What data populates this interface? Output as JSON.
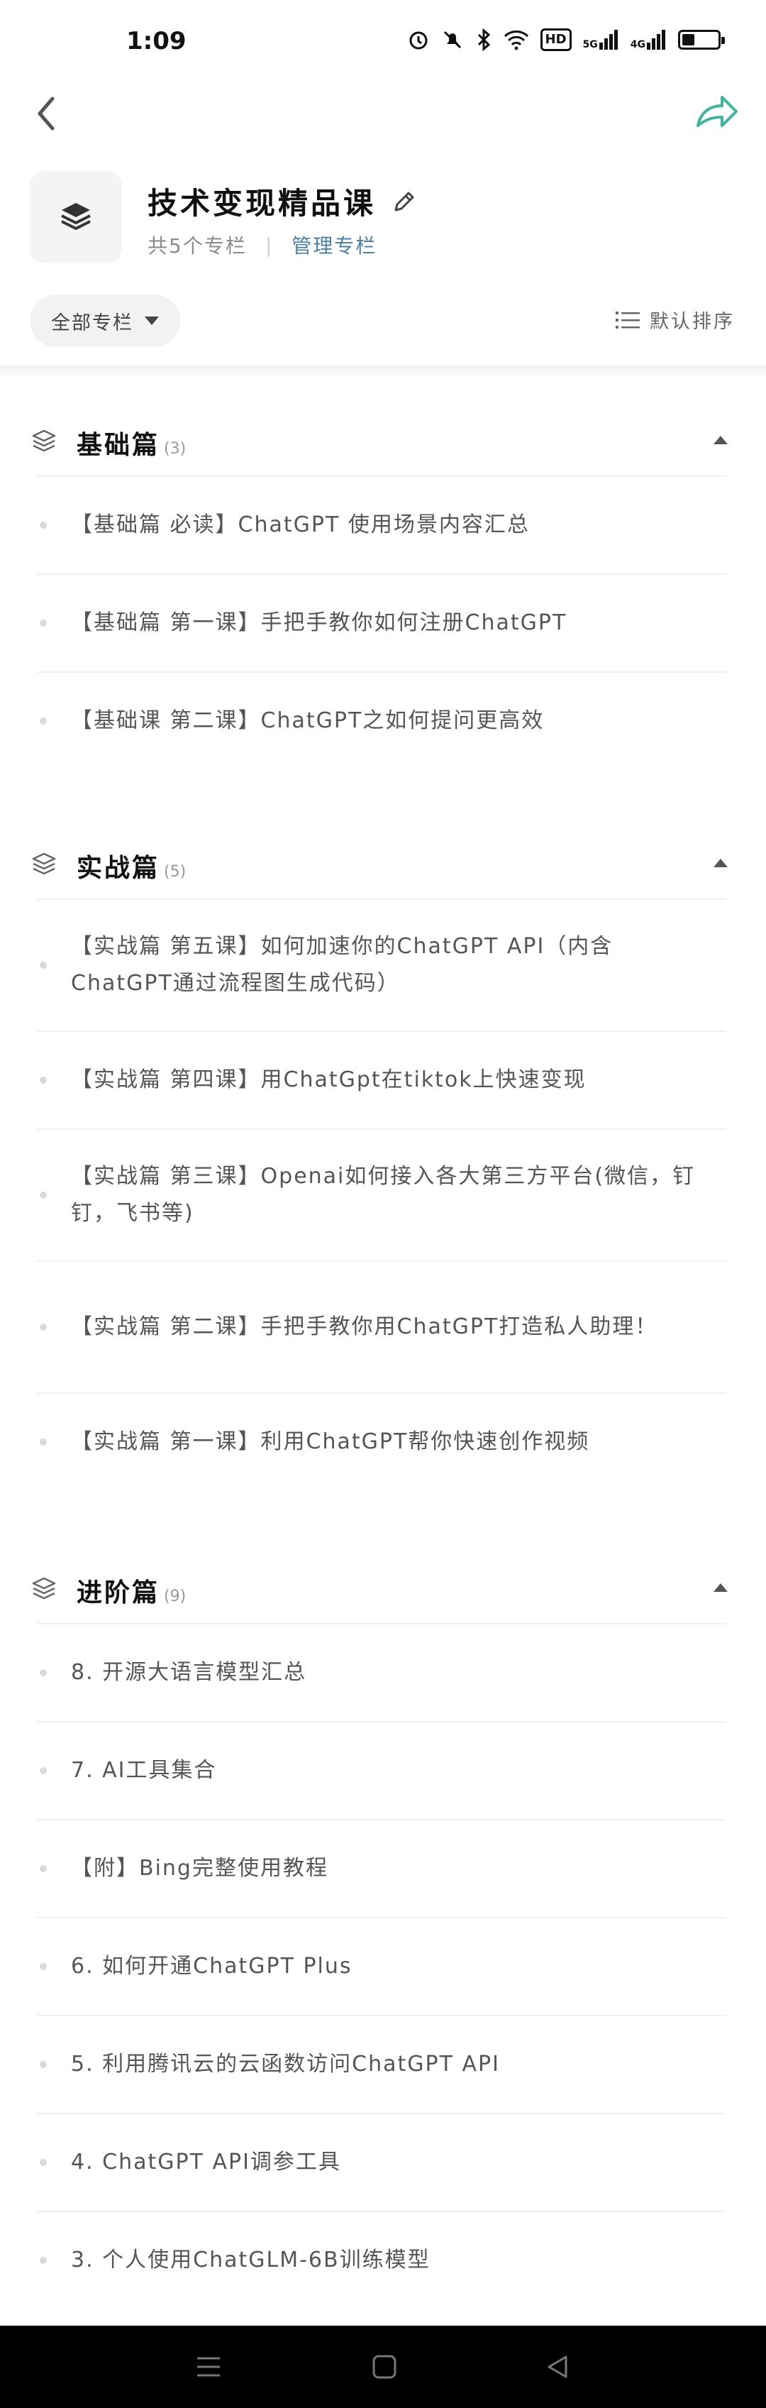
{
  "status_bar": {
    "time": "1:09",
    "hd_badge": "HD",
    "signal1": "5G",
    "signal2": "4G",
    "battery_level": 0.35
  },
  "header": {
    "title": "技术变现精品课",
    "column_count": "共5个专栏",
    "manage_label": "管理专栏",
    "filter_label": "全部专栏",
    "sort_label": "默认排序"
  },
  "sections": [
    {
      "title": "基础篇",
      "count": "(3)",
      "lessons": [
        "【基础篇 必读】ChatGPT 使用场景内容汇总",
        "【基础篇 第一课】手把手教你如何注册ChatGPT",
        "【基础课 第二课】ChatGPT之如何提问更高效"
      ]
    },
    {
      "title": "实战篇",
      "count": "(5)",
      "lessons": [
        "【实战篇 第五课】如何加速你的ChatGPT API（内含ChatGPT通过流程图生成代码）",
        "【实战篇 第四课】用ChatGpt在tiktok上快速变现",
        "【实战篇 第三课】Openai如何接入各大第三方平台(微信，钉钉，飞书等)",
        "【实战篇 第二课】手把手教你用ChatGPT打造私人助理！",
        "【实战篇 第一课】利用ChatGPT帮你快速创作视频"
      ]
    },
    {
      "title": "进阶篇",
      "count": "(9)",
      "lessons": [
        "8. 开源大语言模型汇总",
        "7. AI工具集合",
        "【附】Bing完整使用教程",
        "6. 如何开通ChatGPT Plus",
        "5. 利用腾讯云的云函数访问ChatGPT API",
        "4. ChatGPT API调参工具",
        "3. 个人使用ChatGLM-6B训练模型"
      ]
    }
  ],
  "colors": {
    "accent": "#4a7fa8",
    "share_icon": "#3fb5a0"
  },
  "icons": [
    "back-icon",
    "share-icon",
    "layers-icon",
    "edit-icon",
    "sort-icon",
    "menu-icon",
    "home-icon",
    "back-triangle-icon"
  ]
}
